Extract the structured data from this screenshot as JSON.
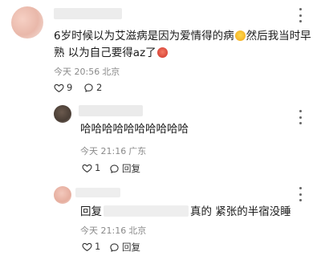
{
  "comments": [
    {
      "text_line1_a": "6岁时候以为艾滋病是因为爱情得的病",
      "text_line1_b": "然后我当时早",
      "text_line2_a": "熟 以为自己要得az了",
      "time": "今天 20:56",
      "location": "北京",
      "likes": "9",
      "replies": "2",
      "emoji1": "grinning-face-icon",
      "emoji2": "love-face-icon"
    },
    {
      "text": "哈哈哈哈哈哈哈哈哈哈",
      "time": "今天 21:16",
      "location": "广东",
      "likes": "1",
      "reply_label": "回复"
    },
    {
      "prefix": "回复",
      "text_after": "真的 紧张的半宿没睡",
      "time": "今天 21:16",
      "location": "北京",
      "likes": "1",
      "reply_label": "回复"
    }
  ],
  "colors": {
    "text": "#1a1a1a",
    "meta": "#8a8a8a",
    "redacted": "#e9e9e9"
  }
}
